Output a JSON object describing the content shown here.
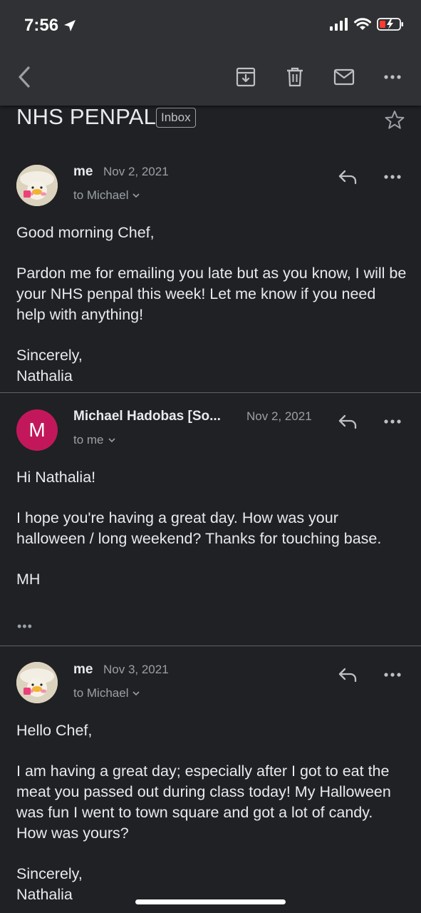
{
  "status": {
    "time": "7:56"
  },
  "subject": {
    "title": "NHS PENPAL",
    "label": "Inbox"
  },
  "colors": {
    "background": "#202124",
    "toolbar": "#303134",
    "avatar_m": "#c2185b"
  },
  "icons": {
    "toolbar": [
      "back-arrow-icon",
      "archive-icon",
      "trash-icon",
      "mail-icon",
      "more-icon"
    ],
    "message": [
      "reply-icon",
      "more-icon"
    ]
  },
  "messages": [
    {
      "sender": "me",
      "date": "Nov 2, 2021",
      "to": "to Michael",
      "avatar_type": "image",
      "body": [
        "Good morning Chef,",
        "Pardon me for emailing you late but as you know, I will be your NHS penpal this week! Let me know if you need help with anything!",
        "Sincerely,\nNathalia"
      ]
    },
    {
      "sender": "Michael Hadobas [So...",
      "date": "Nov 2, 2021",
      "to": "to me",
      "avatar_type": "letter",
      "avatar_letter": "M",
      "body": [
        "Hi Nathalia!",
        "I hope you're having a great day. How was your halloween / long weekend? Thanks for touching base.",
        "MH"
      ],
      "trimmed": "•••"
    },
    {
      "sender": "me",
      "date": "Nov 3, 2021",
      "to": "to Michael",
      "avatar_type": "image",
      "body": [
        "Hello Chef,",
        "I am having a great day; especially after I got to eat the meat you passed out during class today! My Halloween was fun I went to town square and got a lot of candy. How was yours?",
        "Sincerely,\nNathalia"
      ]
    }
  ]
}
